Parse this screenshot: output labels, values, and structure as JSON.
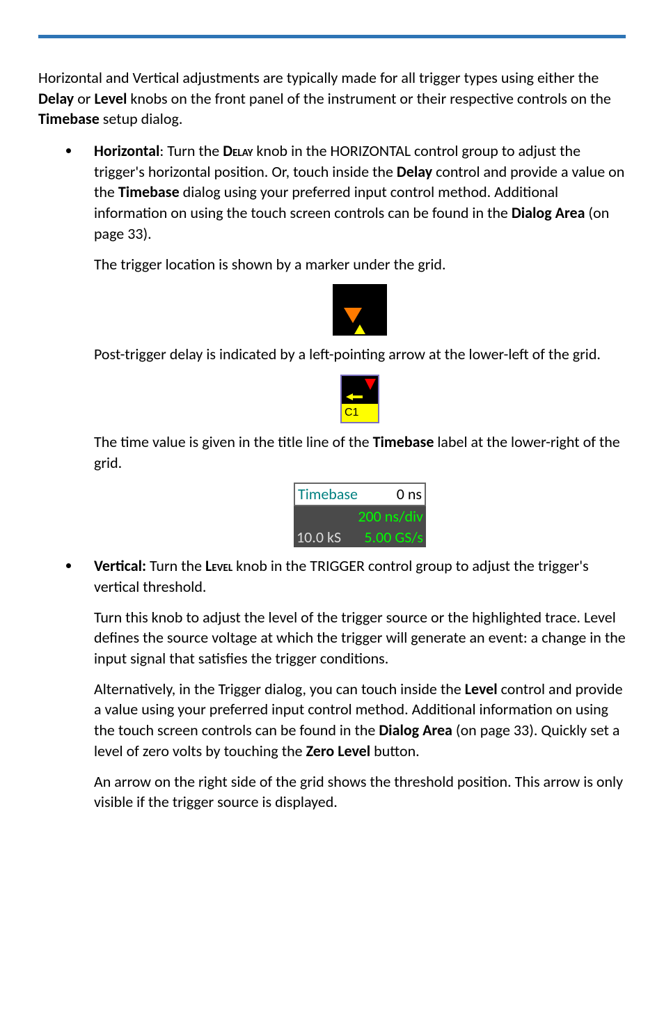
{
  "intro": "Horizontal and Vertical adjustments are typically made for all trigger types using either the ",
  "intro_b1": "Delay",
  "intro_mid1": " or ",
  "intro_b2": "Level",
  "intro_mid2": " knobs on the front panel of the instrument or their respective controls on the ",
  "intro_b3": "Timebase",
  "intro_end": " setup dialog.",
  "horiz": {
    "lead_b": "Horizontal",
    "lead1": ": Turn the ",
    "lead_sc": "Delay",
    "lead2": " knob in the HORIZONTAL control group to adjust the trigger's horizontal position. Or, touch inside the ",
    "lead_b2": "Delay",
    "lead3": " control and provide a value on the ",
    "lead_b3": "Timebase",
    "lead4": " dialog using your preferred input control method. Additional information on using the touch screen controls can be found in the ",
    "lead_b4": "Dialog Area",
    "lead5": " (on page 33).",
    "p2": "The trigger location is shown by a marker under the grid.",
    "p3": "Post-trigger delay is indicated by a left-pointing arrow at the lower-left of the grid.",
    "p4a": "The time value is given in the title line of the ",
    "p4b": "Timebase",
    "p4c": " label at the lower-right of the grid."
  },
  "fig2": {
    "label": "C1"
  },
  "timebase": {
    "title": "Timebase",
    "title_val": "0 ns",
    "row1_r": "200 ns/div",
    "row2_l": "10.0 kS",
    "row2_r": "5.00 GS/s"
  },
  "vert": {
    "lead_b": "Vertical:",
    "lead1": " Turn the ",
    "lead_sc": "Level",
    "lead2": " knob in the TRIGGER control group to adjust the trigger's vertical threshold.",
    "p2": "Turn this knob to adjust the level of the trigger source or the highlighted trace. Level defines the source voltage at which the trigger will generate an event: a change in the input signal that satisfies the trigger conditions.",
    "p3a": "Alternatively, in the Trigger dialog, you can touch inside the ",
    "p3b": "Level",
    "p3c": " control and provide a value using your preferred input control method. Additional information on using the touch screen controls can be found in the ",
    "p3d": "Dialog Area",
    "p3e": " (on page 33). Quickly set a level of zero volts by touching the ",
    "p3f": "Zero Level",
    "p3g": " button.",
    "p4": "An arrow on the right side of the grid shows the threshold position. This arrow is only visible if the trigger source is displayed."
  }
}
